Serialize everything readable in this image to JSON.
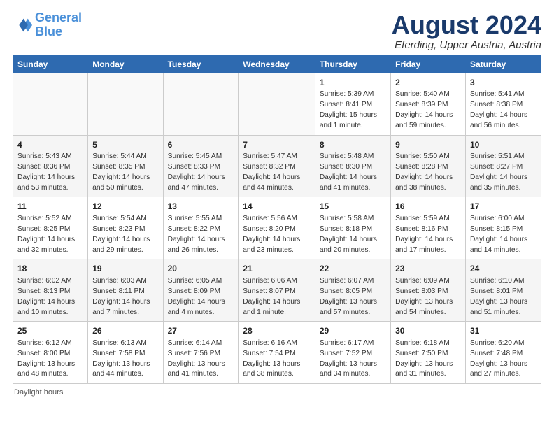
{
  "logo": {
    "line1": "General",
    "line2": "Blue"
  },
  "title": "August 2024",
  "subtitle": "Eferding, Upper Austria, Austria",
  "weekdays": [
    "Sunday",
    "Monday",
    "Tuesday",
    "Wednesday",
    "Thursday",
    "Friday",
    "Saturday"
  ],
  "footer": "Daylight hours",
  "weeks": [
    [
      {
        "day": "",
        "info": ""
      },
      {
        "day": "",
        "info": ""
      },
      {
        "day": "",
        "info": ""
      },
      {
        "day": "",
        "info": ""
      },
      {
        "day": "1",
        "info": "Sunrise: 5:39 AM\nSunset: 8:41 PM\nDaylight: 15 hours\nand 1 minute."
      },
      {
        "day": "2",
        "info": "Sunrise: 5:40 AM\nSunset: 8:39 PM\nDaylight: 14 hours\nand 59 minutes."
      },
      {
        "day": "3",
        "info": "Sunrise: 5:41 AM\nSunset: 8:38 PM\nDaylight: 14 hours\nand 56 minutes."
      }
    ],
    [
      {
        "day": "4",
        "info": "Sunrise: 5:43 AM\nSunset: 8:36 PM\nDaylight: 14 hours\nand 53 minutes."
      },
      {
        "day": "5",
        "info": "Sunrise: 5:44 AM\nSunset: 8:35 PM\nDaylight: 14 hours\nand 50 minutes."
      },
      {
        "day": "6",
        "info": "Sunrise: 5:45 AM\nSunset: 8:33 PM\nDaylight: 14 hours\nand 47 minutes."
      },
      {
        "day": "7",
        "info": "Sunrise: 5:47 AM\nSunset: 8:32 PM\nDaylight: 14 hours\nand 44 minutes."
      },
      {
        "day": "8",
        "info": "Sunrise: 5:48 AM\nSunset: 8:30 PM\nDaylight: 14 hours\nand 41 minutes."
      },
      {
        "day": "9",
        "info": "Sunrise: 5:50 AM\nSunset: 8:28 PM\nDaylight: 14 hours\nand 38 minutes."
      },
      {
        "day": "10",
        "info": "Sunrise: 5:51 AM\nSunset: 8:27 PM\nDaylight: 14 hours\nand 35 minutes."
      }
    ],
    [
      {
        "day": "11",
        "info": "Sunrise: 5:52 AM\nSunset: 8:25 PM\nDaylight: 14 hours\nand 32 minutes."
      },
      {
        "day": "12",
        "info": "Sunrise: 5:54 AM\nSunset: 8:23 PM\nDaylight: 14 hours\nand 29 minutes."
      },
      {
        "day": "13",
        "info": "Sunrise: 5:55 AM\nSunset: 8:22 PM\nDaylight: 14 hours\nand 26 minutes."
      },
      {
        "day": "14",
        "info": "Sunrise: 5:56 AM\nSunset: 8:20 PM\nDaylight: 14 hours\nand 23 minutes."
      },
      {
        "day": "15",
        "info": "Sunrise: 5:58 AM\nSunset: 8:18 PM\nDaylight: 14 hours\nand 20 minutes."
      },
      {
        "day": "16",
        "info": "Sunrise: 5:59 AM\nSunset: 8:16 PM\nDaylight: 14 hours\nand 17 minutes."
      },
      {
        "day": "17",
        "info": "Sunrise: 6:00 AM\nSunset: 8:15 PM\nDaylight: 14 hours\nand 14 minutes."
      }
    ],
    [
      {
        "day": "18",
        "info": "Sunrise: 6:02 AM\nSunset: 8:13 PM\nDaylight: 14 hours\nand 10 minutes."
      },
      {
        "day": "19",
        "info": "Sunrise: 6:03 AM\nSunset: 8:11 PM\nDaylight: 14 hours\nand 7 minutes."
      },
      {
        "day": "20",
        "info": "Sunrise: 6:05 AM\nSunset: 8:09 PM\nDaylight: 14 hours\nand 4 minutes."
      },
      {
        "day": "21",
        "info": "Sunrise: 6:06 AM\nSunset: 8:07 PM\nDaylight: 14 hours\nand 1 minute."
      },
      {
        "day": "22",
        "info": "Sunrise: 6:07 AM\nSunset: 8:05 PM\nDaylight: 13 hours\nand 57 minutes."
      },
      {
        "day": "23",
        "info": "Sunrise: 6:09 AM\nSunset: 8:03 PM\nDaylight: 13 hours\nand 54 minutes."
      },
      {
        "day": "24",
        "info": "Sunrise: 6:10 AM\nSunset: 8:01 PM\nDaylight: 13 hours\nand 51 minutes."
      }
    ],
    [
      {
        "day": "25",
        "info": "Sunrise: 6:12 AM\nSunset: 8:00 PM\nDaylight: 13 hours\nand 48 minutes."
      },
      {
        "day": "26",
        "info": "Sunrise: 6:13 AM\nSunset: 7:58 PM\nDaylight: 13 hours\nand 44 minutes."
      },
      {
        "day": "27",
        "info": "Sunrise: 6:14 AM\nSunset: 7:56 PM\nDaylight: 13 hours\nand 41 minutes."
      },
      {
        "day": "28",
        "info": "Sunrise: 6:16 AM\nSunset: 7:54 PM\nDaylight: 13 hours\nand 38 minutes."
      },
      {
        "day": "29",
        "info": "Sunrise: 6:17 AM\nSunset: 7:52 PM\nDaylight: 13 hours\nand 34 minutes."
      },
      {
        "day": "30",
        "info": "Sunrise: 6:18 AM\nSunset: 7:50 PM\nDaylight: 13 hours\nand 31 minutes."
      },
      {
        "day": "31",
        "info": "Sunrise: 6:20 AM\nSunset: 7:48 PM\nDaylight: 13 hours\nand 27 minutes."
      }
    ]
  ]
}
